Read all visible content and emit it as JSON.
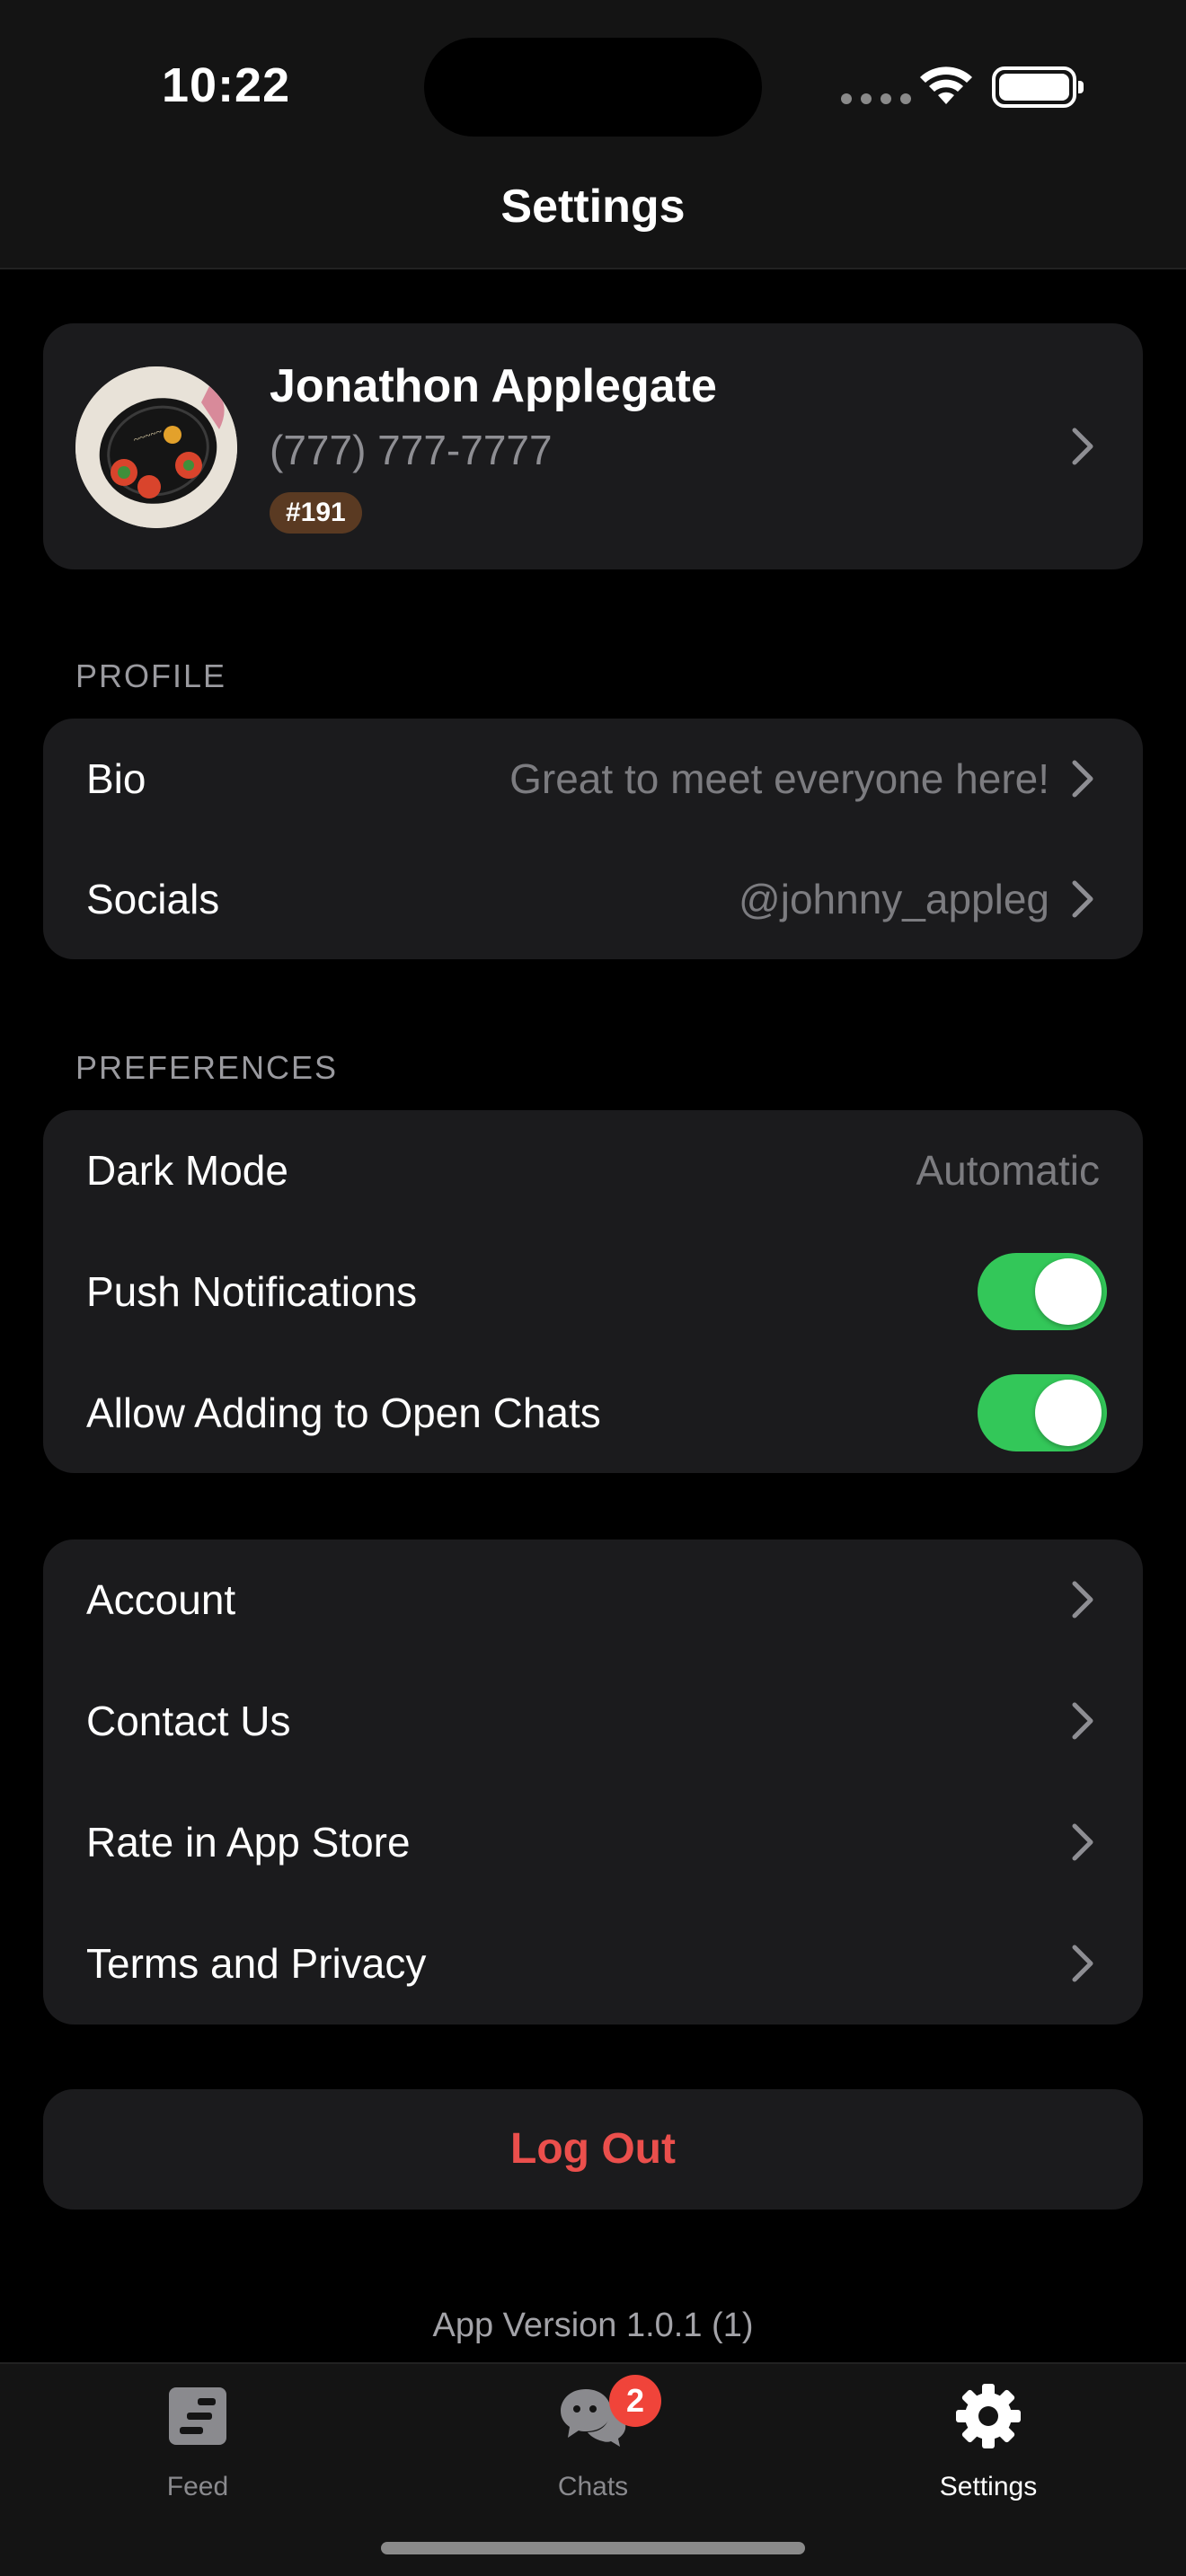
{
  "status_bar": {
    "time": "10:22"
  },
  "header": {
    "title": "Settings"
  },
  "profile": {
    "name": "Jonathon Applegate",
    "phone": "(777) 777-7777",
    "badge": "#191"
  },
  "sections": {
    "profile_label": "PROFILE",
    "preferences_label": "PREFERENCES"
  },
  "profile_rows": [
    {
      "label": "Bio",
      "value": "Great to meet everyone here!"
    },
    {
      "label": "Socials",
      "value": "@johnny_appleg"
    }
  ],
  "preferences": [
    {
      "label": "Dark Mode",
      "value": "Automatic"
    },
    {
      "label": "Push Notifications",
      "toggle": true
    },
    {
      "label": "Allow Adding to Open Chats",
      "toggle": true
    }
  ],
  "links": [
    {
      "label": "Account"
    },
    {
      "label": "Contact Us"
    },
    {
      "label": "Rate in App Store"
    },
    {
      "label": "Terms and Privacy"
    }
  ],
  "logout": {
    "label": "Log Out"
  },
  "footer": {
    "version": "App Version 1.0.1 (1)"
  },
  "tabbar": {
    "tabs": [
      {
        "label": "Feed",
        "icon": "feed-icon"
      },
      {
        "label": "Chats",
        "icon": "chats-icon",
        "badge": "2"
      },
      {
        "label": "Settings",
        "icon": "gear-icon",
        "active": true
      }
    ]
  },
  "colors": {
    "accent_toggle": "#33c759",
    "destructive": "#eb4f4c",
    "badge_bg": "#5a3a22",
    "tab_badge": "#f0443a"
  }
}
